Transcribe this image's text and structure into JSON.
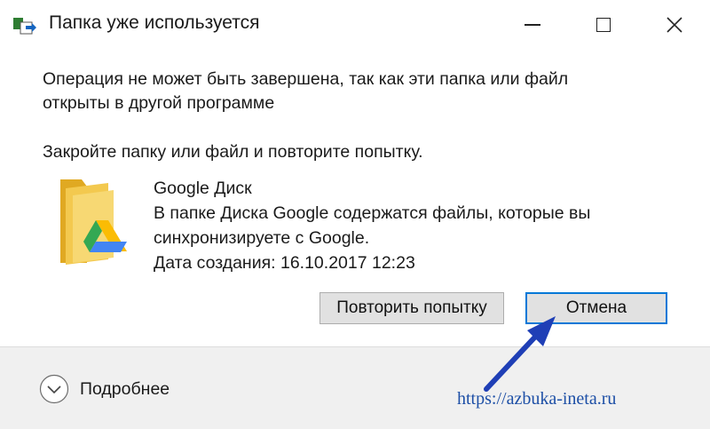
{
  "window": {
    "title": "Папка уже используется",
    "icon": "move-files-icon",
    "controls": [
      "minimize-icon",
      "maximize-icon",
      "close-icon"
    ]
  },
  "message": {
    "line1": "Операция не может быть завершена, так как эти папка или файл",
    "line2": "открыты в другой программе",
    "instruction": "Закройте папку или файл и повторите попытку."
  },
  "item": {
    "icon": "google-drive-folder-icon",
    "name": "Google Диск",
    "description_line1": "В папке Диска Google содержатся файлы, которые вы",
    "description_line2": "синхронизируете с Google.",
    "created": "Дата создания: 16.10.2017 12:23"
  },
  "buttons": {
    "retry_label": "Повторить попытку",
    "cancel_label": "Отмена"
  },
  "footer": {
    "more_label": "Подробнее",
    "watermark": "https://azbuka-ineta.ru"
  },
  "colors": {
    "focus_border": "#0078d7",
    "annotation_arrow": "#1f3fb6",
    "folder_yellow": "#f3c94f"
  }
}
